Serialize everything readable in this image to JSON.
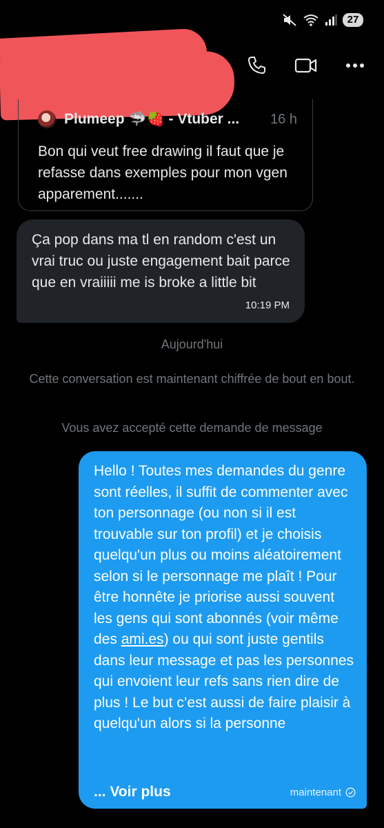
{
  "status_bar": {
    "battery": "27",
    "icons": [
      "mute-icon",
      "wifi-icon",
      "signal-icon"
    ]
  },
  "header": {
    "contact_name_redacted": true,
    "actions": [
      "phone-icon",
      "video-call-icon",
      "more-icon"
    ]
  },
  "quoted_post": {
    "author": "Plumeep 🦈🍓 - Vtuber ...",
    "time": "16 h",
    "text": "Bon qui veut free drawing il faut que je refasse dans exemples pour mon vgen apparement......."
  },
  "incoming_message": {
    "text": "Ça pop dans ma tl en random c'est un vrai truc ou juste engagement bait parce que en vraiiiii me is broke a little bit",
    "time": "10:19 PM"
  },
  "system_messages": {
    "date": "Aujourd'hui",
    "encryption": "Cette conversation est maintenant chiffrée de bout en bout.",
    "accepted": "Vous avez accepté cette demande de message"
  },
  "outgoing_message": {
    "text_before_link": "Hello ! Toutes mes demandes du genre sont réelles, il suffit de commenter avec ton personnage (ou non si il est trouvable sur ton profil) et je choisis quelqu'un plus ou moins aléatoirement selon si le personnage me plaît ! Pour être honnête je priorise aussi souvent les gens qui sont abonnés (voir même des ",
    "link": "ami.es",
    "text_after_link": ") ou qui sont juste gentils dans leur message et pas les personnes qui envoient leur refs sans rien dire de plus ! Le but c’est aussi de faire plaisir à quelqu'un alors si la personne",
    "see_more": "... Voir plus",
    "time": "maintenant"
  },
  "colors": {
    "background": "#000000",
    "incoming_bubble": "#202327",
    "outgoing_bubble": "#1d9bf0",
    "muted_text": "#71767b",
    "redaction": "#f0555a"
  }
}
